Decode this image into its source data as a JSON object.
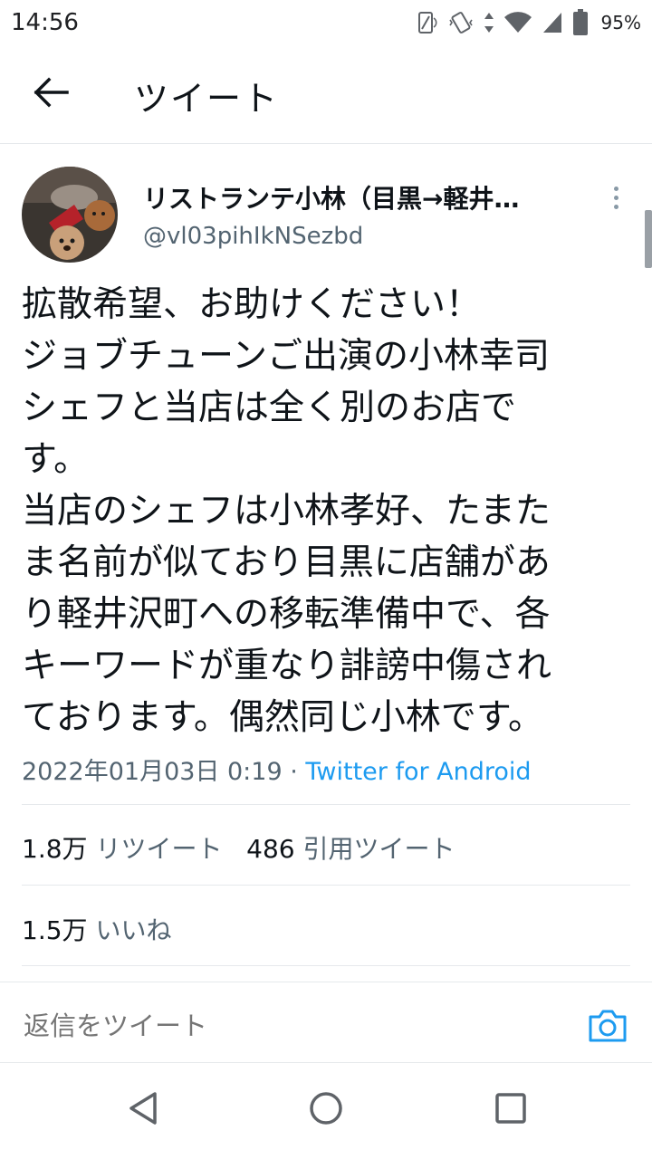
{
  "status_bar": {
    "time": "14:56",
    "battery_percent": "95%",
    "icons": [
      "screen-rotate-icon",
      "vibrate-icon",
      "data-arrows-icon",
      "wifi-icon",
      "cell-signal-icon",
      "battery-icon"
    ]
  },
  "app_bar": {
    "back_icon": "back-arrow-icon",
    "title": "ツイート"
  },
  "tweet": {
    "author_name": "リストランテ小林（目黒→軽井…",
    "author_handle": "@vl03pihIkNSezbd",
    "text_lines": [
      "拡散希望、お助けください！",
      "ジョブチューンご出演の小林幸司",
      "シェフと当店は全く別のお店で",
      "す。",
      "当店のシェフは小林孝好、たまた",
      "ま名前が似ており目黒に店舗があ",
      "り軽井沢町への移転準備中で、各",
      "キーワードが重なり誹謗中傷され",
      "ております。偶然同じ小林です。"
    ],
    "timestamp": "2022年01月03日 0:19",
    "separator": " · ",
    "source": "Twitter for Android",
    "retweets_count": "1.8万",
    "retweets_label": "リツイート",
    "quotes_count": "486",
    "quotes_label": "引用ツイート",
    "likes_count": "1.5万",
    "likes_label": "いいね"
  },
  "reply": {
    "placeholder": "返信をツイート",
    "camera_icon": "camera-icon"
  },
  "nav_bar": {
    "icons": [
      "back-triangle-icon",
      "home-circle-icon",
      "recents-square-icon"
    ]
  },
  "colors": {
    "text": "#0f1419",
    "secondary": "#536471",
    "link": "#1d9bf0",
    "divider": "#e6e9ec"
  }
}
